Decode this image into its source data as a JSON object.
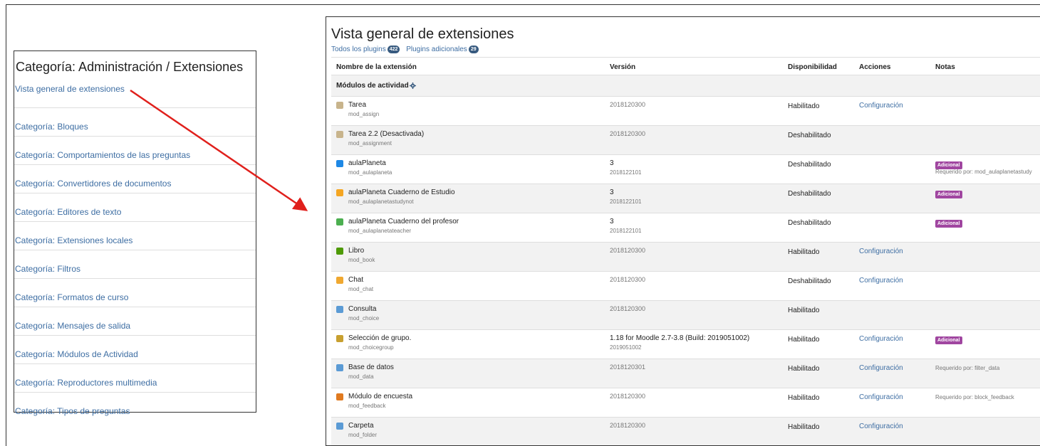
{
  "colors": {
    "link": "#3e6ea3",
    "arrow": "#e0201c",
    "badge_additional": "#a046a0",
    "badge_count": "#375a7f"
  },
  "categories_panel": {
    "title": "Categoría: Administración / Extensiones",
    "items": [
      "Vista general de extensiones",
      "Categoría: Bloques",
      "Categoría: Comportamientos de las preguntas",
      "Categoría: Convertidores de documentos",
      "Categoría: Editores de texto",
      "Categoría: Extensiones locales",
      "Categoría: Filtros",
      "Categoría: Formatos de curso",
      "Categoría: Mensajes de salida",
      "Categoría: Módulos de Actividad",
      "Categoría: Reproductores multimedia",
      "Categoría: Tipos de preguntas"
    ]
  },
  "overview": {
    "title": "Vista general de extensiones",
    "all_plugins_label": "Todos los plugins",
    "all_plugins_count": "422",
    "additional_plugins_label": "Plugins adicionales",
    "additional_plugins_count": "29",
    "columns": {
      "name": "Nombre de la extensión",
      "version": "Versión",
      "availability": "Disponibilidad",
      "actions": "Acciones",
      "notes": "Notas"
    },
    "section_title": "Módulos de actividad",
    "section_icon": "gear-icon",
    "plugins": [
      {
        "name": "Tarea",
        "component": "mod_assign",
        "version": "2018120300",
        "release": "",
        "availability": "Habilitado",
        "action": "Configuración",
        "badge": "",
        "required": "",
        "icon": "assign-icon",
        "icon_color": "#c8b48c"
      },
      {
        "name": "Tarea 2.2 (Desactivada)",
        "component": "mod_assignment",
        "version": "2018120300",
        "release": "",
        "availability": "Deshabilitado",
        "action": "",
        "badge": "",
        "required": "",
        "icon": "assignment-icon",
        "icon_color": "#c8b48c"
      },
      {
        "name": "aulaPlaneta",
        "component": "mod_aulaplaneta",
        "version": "2018122101",
        "release": "3",
        "availability": "Deshabilitado",
        "action": "",
        "badge": "Adicional",
        "required": "Requerido por: mod_aulaplanetastudy",
        "icon": "aulaplaneta-icon",
        "icon_color": "#1e88e5"
      },
      {
        "name": "aulaPlaneta Cuaderno de Estudio",
        "component": "mod_aulaplanetastudynot",
        "version": "2018122101",
        "release": "3",
        "availability": "Deshabilitado",
        "action": "",
        "badge": "Adicional",
        "required": "",
        "icon": "aulaplaneta-study-icon",
        "icon_color": "#f5a623"
      },
      {
        "name": "aulaPlaneta Cuaderno del profesor",
        "component": "mod_aulaplanetateacher",
        "version": "2018122101",
        "release": "3",
        "availability": "Deshabilitado",
        "action": "",
        "badge": "Adicional",
        "required": "",
        "icon": "aulaplaneta-teacher-icon",
        "icon_color": "#4caf50"
      },
      {
        "name": "Libro",
        "component": "mod_book",
        "version": "2018120300",
        "release": "",
        "availability": "Habilitado",
        "action": "Configuración",
        "badge": "",
        "required": "",
        "icon": "book-icon",
        "icon_color": "#4e9a06"
      },
      {
        "name": "Chat",
        "component": "mod_chat",
        "version": "2018120300",
        "release": "",
        "availability": "Deshabilitado",
        "action": "Configuración",
        "badge": "",
        "required": "",
        "icon": "chat-icon",
        "icon_color": "#f0a830"
      },
      {
        "name": "Consulta",
        "component": "mod_choice",
        "version": "2018120300",
        "release": "",
        "availability": "Habilitado",
        "action": "",
        "badge": "",
        "required": "",
        "icon": "choice-icon",
        "icon_color": "#5b9bd5"
      },
      {
        "name": "Selección de grupo.",
        "component": "mod_choicegroup",
        "version": "2019051002",
        "release": "1.18 for Moodle 2.7-3.8 (Build: 2019051002)",
        "availability": "Habilitado",
        "action": "Configuración",
        "badge": "Adicional",
        "required": "",
        "icon": "choicegroup-icon",
        "icon_color": "#c8a030"
      },
      {
        "name": "Base de datos",
        "component": "mod_data",
        "version": "2018120301",
        "release": "",
        "availability": "Habilitado",
        "action": "Configuración",
        "badge": "",
        "required": "Requerido por: filter_data",
        "icon": "database-icon",
        "icon_color": "#5b9bd5"
      },
      {
        "name": "Módulo de encuesta",
        "component": "mod_feedback",
        "version": "2018120300",
        "release": "",
        "availability": "Habilitado",
        "action": "Configuración",
        "badge": "",
        "required": "Requerido por: block_feedback",
        "icon": "feedback-icon",
        "icon_color": "#e07a20"
      },
      {
        "name": "Carpeta",
        "component": "mod_folder",
        "version": "2018120300",
        "release": "",
        "availability": "Habilitado",
        "action": "Configuración",
        "badge": "",
        "required": "",
        "icon": "folder-icon",
        "icon_color": "#5b9bd5"
      }
    ]
  }
}
